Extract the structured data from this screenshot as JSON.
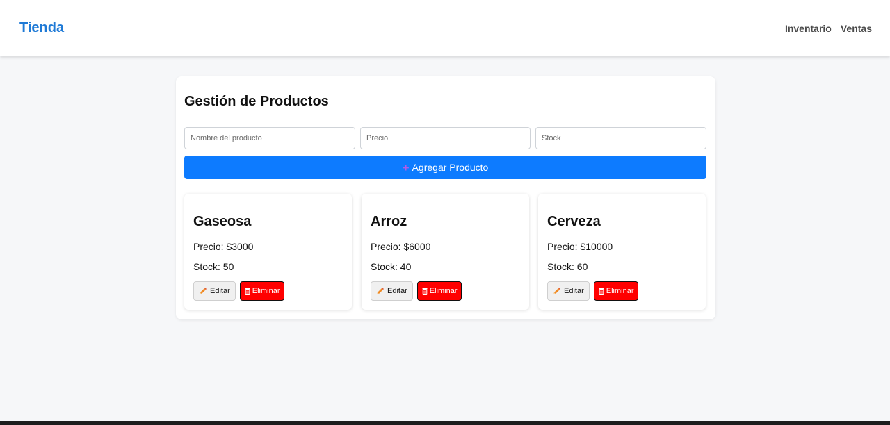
{
  "nav": {
    "brand": "Tienda",
    "links": [
      "Inventario",
      "Ventas"
    ]
  },
  "panel": {
    "title": "Gestión de Productos",
    "inputs": {
      "name_placeholder": "Nombre del producto",
      "price_placeholder": "Precio",
      "stock_placeholder": "Stock"
    },
    "add_button": {
      "icon": "plus-icon",
      "label": "Agregar Producto"
    }
  },
  "products": [
    {
      "name": "Gaseosa",
      "price": "Precio: $3000",
      "stock": "Stock: 50",
      "edit_label": "Editar",
      "delete_label": "Eliminar"
    },
    {
      "name": "Arroz",
      "price": "Precio: $6000",
      "stock": "Stock: 40",
      "edit_label": "Editar",
      "delete_label": "Eliminar"
    },
    {
      "name": "Cerveza",
      "price": "Precio: $10000",
      "stock": "Stock: 60",
      "edit_label": "Editar",
      "delete_label": "Eliminar"
    }
  ],
  "colors": {
    "brand": "#1f7ad6",
    "primary_button": "#0d7bff",
    "danger_button": "#ff0000"
  }
}
